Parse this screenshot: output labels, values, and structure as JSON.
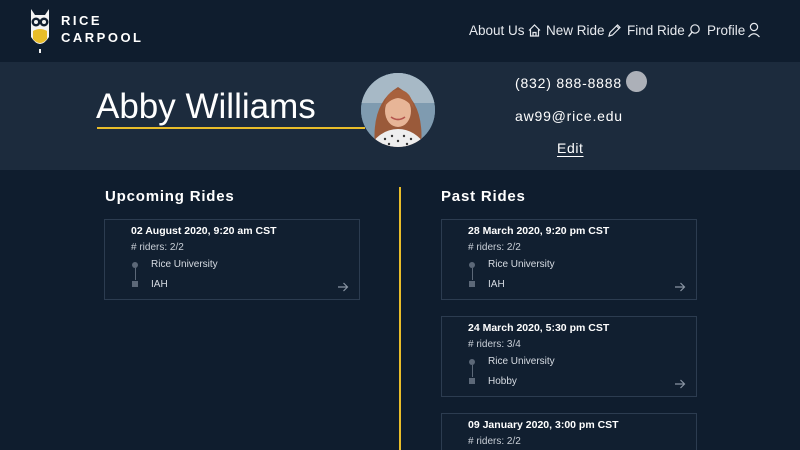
{
  "header": {
    "brand_line1": "RICE",
    "brand_line2": "CARPOOL",
    "logo_icon": "owl-logo-icon",
    "nav": [
      {
        "label": "About Us",
        "icon": "home-icon"
      },
      {
        "label": "New Ride",
        "icon": "pencil-icon"
      },
      {
        "label": "Find Ride",
        "icon": "search-icon"
      },
      {
        "label": "Profile",
        "icon": "user-icon"
      }
    ]
  },
  "profile": {
    "name": "Abby Williams",
    "phone": "(832) 888-8888",
    "email": "aw99@rice.edu",
    "edit_label": "Edit"
  },
  "upcoming": {
    "title": "Upcoming Rides",
    "rides": [
      {
        "date": "02 August 2020, 9:20 am CST",
        "riders": "# riders: 2/2",
        "from": "Rice University",
        "to": "IAH"
      }
    ]
  },
  "past": {
    "title": "Past Rides",
    "rides": [
      {
        "date": "28 March 2020, 9:20 pm CST",
        "riders": "# riders: 2/2",
        "from": "Rice University",
        "to": "IAH"
      },
      {
        "date": "24 March 2020, 5:30 pm CST",
        "riders": "# riders: 3/4",
        "from": "Rice University",
        "to": "Hobby"
      },
      {
        "date": "09 January 2020, 3:00 pm CST",
        "riders": "# riders: 2/2",
        "from": "",
        "to": ""
      }
    ]
  },
  "colors": {
    "background": "#0f1d2e",
    "band": "#1c2b3d",
    "accent": "#e9bd2a"
  }
}
